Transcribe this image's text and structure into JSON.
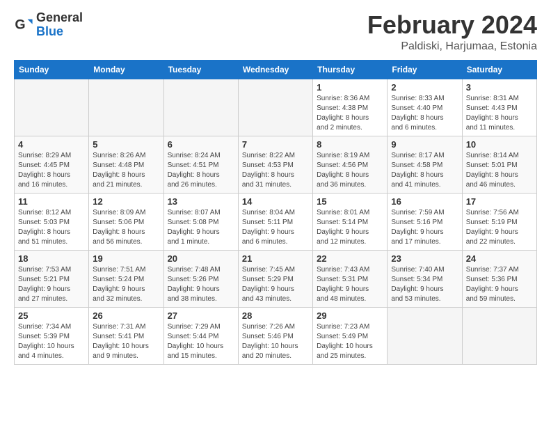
{
  "header": {
    "logo_general": "General",
    "logo_blue": "Blue",
    "month": "February 2024",
    "location": "Paldiski, Harjumaa, Estonia"
  },
  "columns": [
    "Sunday",
    "Monday",
    "Tuesday",
    "Wednesday",
    "Thursday",
    "Friday",
    "Saturday"
  ],
  "weeks": [
    [
      {
        "day": "",
        "info": ""
      },
      {
        "day": "",
        "info": ""
      },
      {
        "day": "",
        "info": ""
      },
      {
        "day": "",
        "info": ""
      },
      {
        "day": "1",
        "info": "Sunrise: 8:36 AM\nSunset: 4:38 PM\nDaylight: 8 hours\nand 2 minutes."
      },
      {
        "day": "2",
        "info": "Sunrise: 8:33 AM\nSunset: 4:40 PM\nDaylight: 8 hours\nand 6 minutes."
      },
      {
        "day": "3",
        "info": "Sunrise: 8:31 AM\nSunset: 4:43 PM\nDaylight: 8 hours\nand 11 minutes."
      }
    ],
    [
      {
        "day": "4",
        "info": "Sunrise: 8:29 AM\nSunset: 4:45 PM\nDaylight: 8 hours\nand 16 minutes."
      },
      {
        "day": "5",
        "info": "Sunrise: 8:26 AM\nSunset: 4:48 PM\nDaylight: 8 hours\nand 21 minutes."
      },
      {
        "day": "6",
        "info": "Sunrise: 8:24 AM\nSunset: 4:51 PM\nDaylight: 8 hours\nand 26 minutes."
      },
      {
        "day": "7",
        "info": "Sunrise: 8:22 AM\nSunset: 4:53 PM\nDaylight: 8 hours\nand 31 minutes."
      },
      {
        "day": "8",
        "info": "Sunrise: 8:19 AM\nSunset: 4:56 PM\nDaylight: 8 hours\nand 36 minutes."
      },
      {
        "day": "9",
        "info": "Sunrise: 8:17 AM\nSunset: 4:58 PM\nDaylight: 8 hours\nand 41 minutes."
      },
      {
        "day": "10",
        "info": "Sunrise: 8:14 AM\nSunset: 5:01 PM\nDaylight: 8 hours\nand 46 minutes."
      }
    ],
    [
      {
        "day": "11",
        "info": "Sunrise: 8:12 AM\nSunset: 5:03 PM\nDaylight: 8 hours\nand 51 minutes."
      },
      {
        "day": "12",
        "info": "Sunrise: 8:09 AM\nSunset: 5:06 PM\nDaylight: 8 hours\nand 56 minutes."
      },
      {
        "day": "13",
        "info": "Sunrise: 8:07 AM\nSunset: 5:08 PM\nDaylight: 9 hours\nand 1 minute."
      },
      {
        "day": "14",
        "info": "Sunrise: 8:04 AM\nSunset: 5:11 PM\nDaylight: 9 hours\nand 6 minutes."
      },
      {
        "day": "15",
        "info": "Sunrise: 8:01 AM\nSunset: 5:14 PM\nDaylight: 9 hours\nand 12 minutes."
      },
      {
        "day": "16",
        "info": "Sunrise: 7:59 AM\nSunset: 5:16 PM\nDaylight: 9 hours\nand 17 minutes."
      },
      {
        "day": "17",
        "info": "Sunrise: 7:56 AM\nSunset: 5:19 PM\nDaylight: 9 hours\nand 22 minutes."
      }
    ],
    [
      {
        "day": "18",
        "info": "Sunrise: 7:53 AM\nSunset: 5:21 PM\nDaylight: 9 hours\nand 27 minutes."
      },
      {
        "day": "19",
        "info": "Sunrise: 7:51 AM\nSunset: 5:24 PM\nDaylight: 9 hours\nand 32 minutes."
      },
      {
        "day": "20",
        "info": "Sunrise: 7:48 AM\nSunset: 5:26 PM\nDaylight: 9 hours\nand 38 minutes."
      },
      {
        "day": "21",
        "info": "Sunrise: 7:45 AM\nSunset: 5:29 PM\nDaylight: 9 hours\nand 43 minutes."
      },
      {
        "day": "22",
        "info": "Sunrise: 7:43 AM\nSunset: 5:31 PM\nDaylight: 9 hours\nand 48 minutes."
      },
      {
        "day": "23",
        "info": "Sunrise: 7:40 AM\nSunset: 5:34 PM\nDaylight: 9 hours\nand 53 minutes."
      },
      {
        "day": "24",
        "info": "Sunrise: 7:37 AM\nSunset: 5:36 PM\nDaylight: 9 hours\nand 59 minutes."
      }
    ],
    [
      {
        "day": "25",
        "info": "Sunrise: 7:34 AM\nSunset: 5:39 PM\nDaylight: 10 hours\nand 4 minutes."
      },
      {
        "day": "26",
        "info": "Sunrise: 7:31 AM\nSunset: 5:41 PM\nDaylight: 10 hours\nand 9 minutes."
      },
      {
        "day": "27",
        "info": "Sunrise: 7:29 AM\nSunset: 5:44 PM\nDaylight: 10 hours\nand 15 minutes."
      },
      {
        "day": "28",
        "info": "Sunrise: 7:26 AM\nSunset: 5:46 PM\nDaylight: 10 hours\nand 20 minutes."
      },
      {
        "day": "29",
        "info": "Sunrise: 7:23 AM\nSunset: 5:49 PM\nDaylight: 10 hours\nand 25 minutes."
      },
      {
        "day": "",
        "info": ""
      },
      {
        "day": "",
        "info": ""
      }
    ]
  ]
}
